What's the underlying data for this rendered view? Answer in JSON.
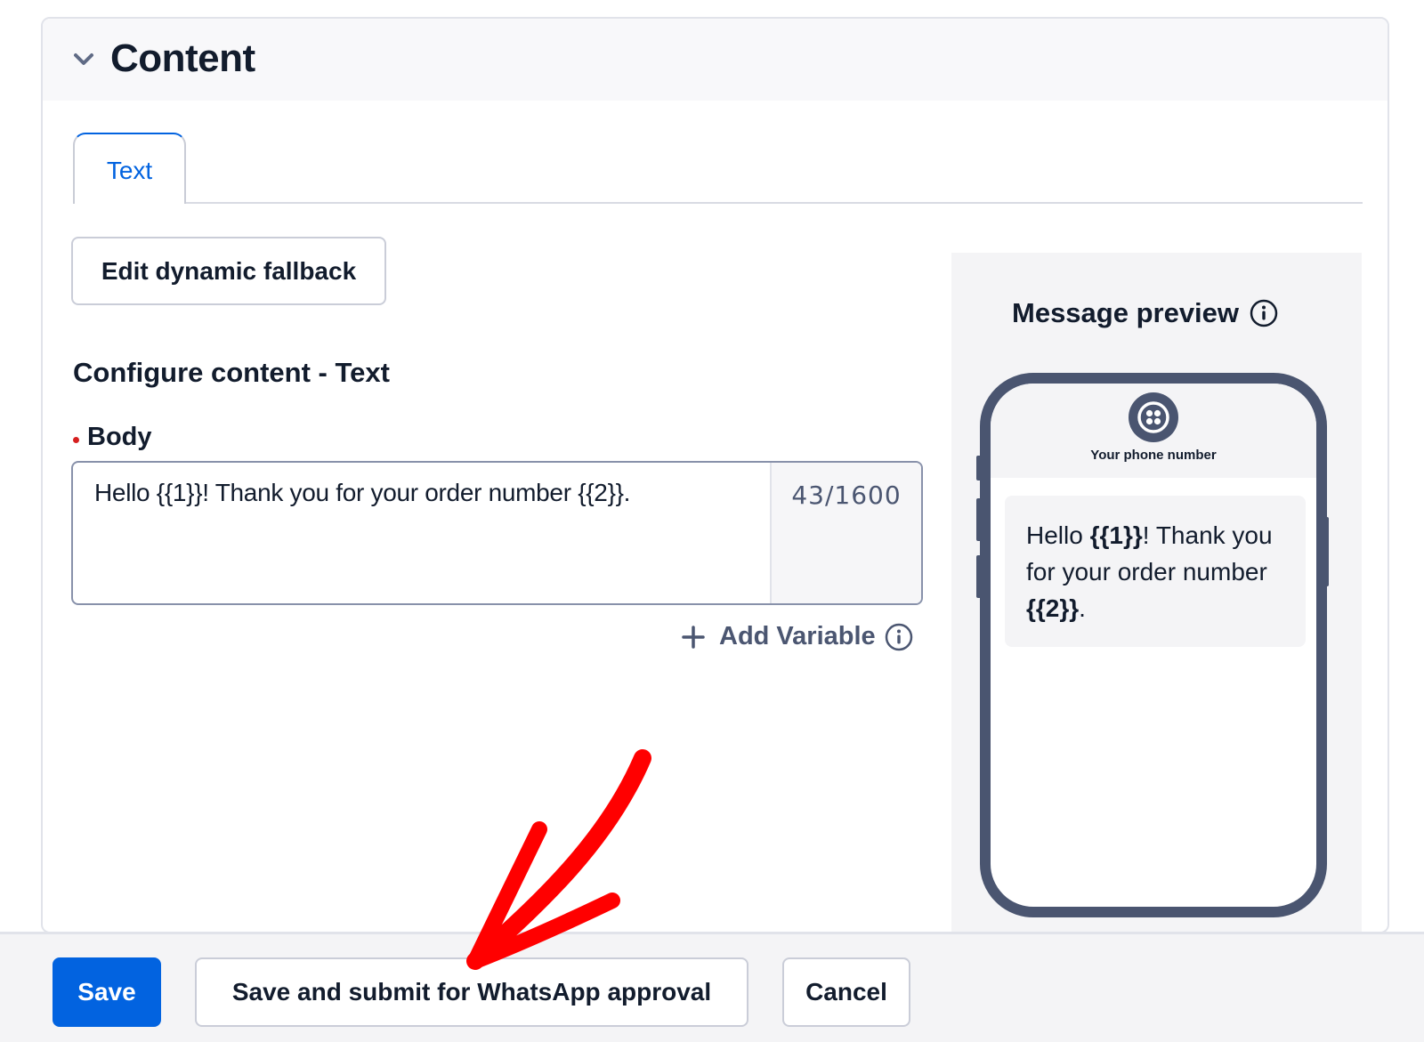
{
  "section": {
    "title": "Content",
    "expanded": true
  },
  "tabs": [
    {
      "label": "Text",
      "active": true
    }
  ],
  "buttons": {
    "edit_fallback": "Edit dynamic fallback",
    "add_variable": "Add Variable",
    "save": "Save",
    "save_submit": "Save and submit for WhatsApp approval",
    "cancel": "Cancel"
  },
  "configure": {
    "heading": "Configure content - Text",
    "body_label": "Body",
    "body_required": true,
    "body_value": "Hello {{1}}! Thank you for your order number {{2}}.",
    "char_count": "43/1600"
  },
  "preview": {
    "title": "Message preview",
    "sender": "Your phone number",
    "message_parts": {
      "p1": "Hello ",
      "var1": "{{1}}",
      "p2": "! Thank you for your order number ",
      "var2": "{{2}}",
      "p3": "."
    }
  },
  "icons": {
    "section_toggle": "chevron-down-icon",
    "add": "plus-icon",
    "info": "info-icon",
    "avatar": "twilio-logo-icon"
  },
  "colors": {
    "primary": "#0263e0",
    "text": "#121c2d",
    "muted": "#4b5671",
    "phone_frame": "#4a5570",
    "annotation": "#ff0000",
    "required": "#d61f1f"
  },
  "annotation": {
    "type": "arrow",
    "target": "save-submit-button"
  }
}
